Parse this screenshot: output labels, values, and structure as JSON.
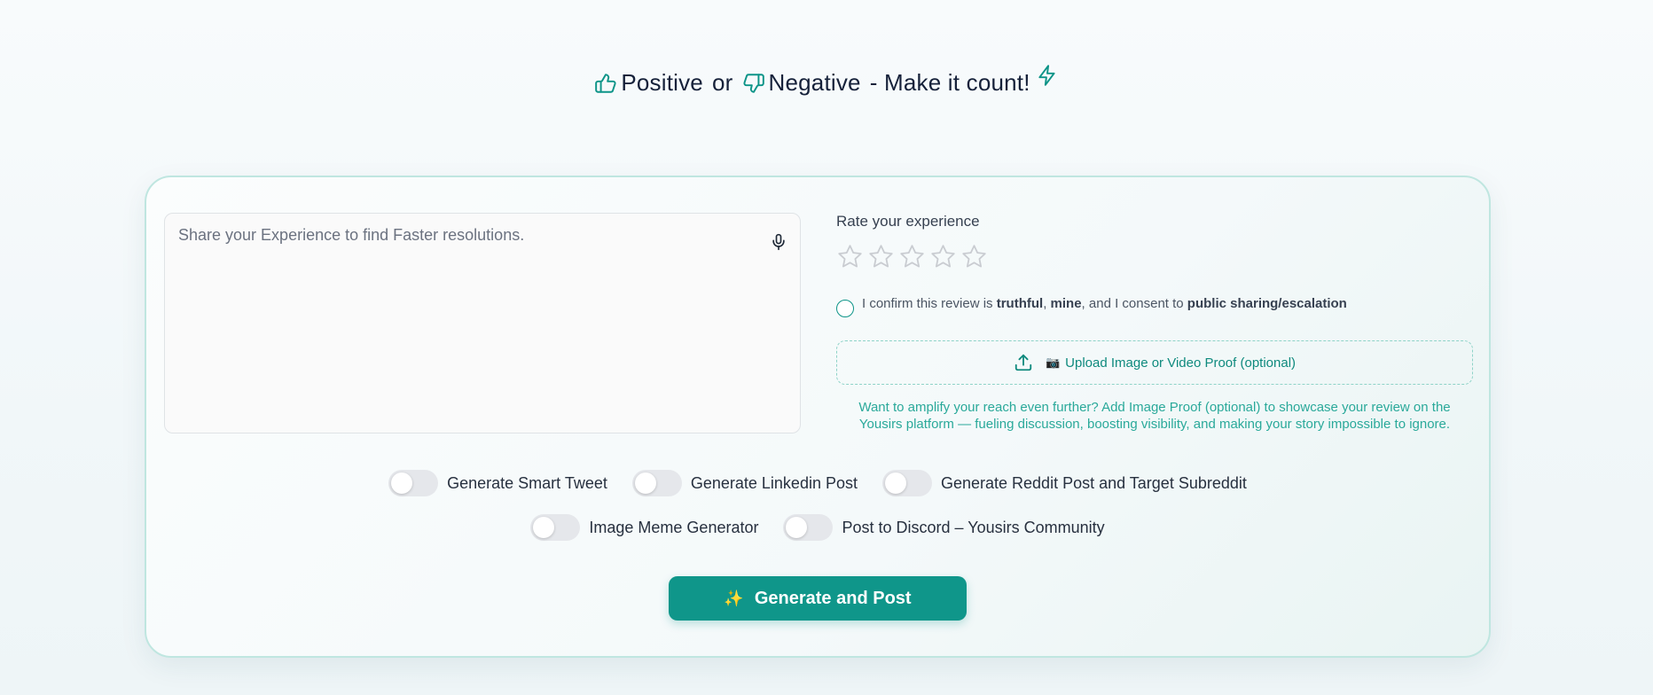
{
  "headline": {
    "positive": "Positive",
    "or": "or",
    "negative": "Negative",
    "tagline": "- Make it count!",
    "icons": [
      "thumbs-up-icon",
      "thumbs-down-icon",
      "lightning-icon"
    ],
    "accent_color": "#0d9488"
  },
  "review": {
    "placeholder": "Share your Experience to find Faster resolutions.",
    "mic_icon": "microphone-icon"
  },
  "rating": {
    "label": "Rate your experience",
    "max_stars": 5,
    "selected": 0
  },
  "consent": {
    "part1": "I confirm this review is ",
    "truthful": "truthful",
    "comma": ", ",
    "mine": "mine",
    "part2": ", and I consent to ",
    "public": "public sharing/escalation",
    "checked": false
  },
  "upload": {
    "camera": "📷",
    "label": "Upload Image or Video Proof (optional)"
  },
  "promo": {
    "line1": "Want to amplify your reach even further? Add Image Proof (optional) to showcase your review on the",
    "line2": "Yousirs platform — fueling discussion, boosting visibility, and making your story impossible to ignore."
  },
  "toggles": {
    "row1": [
      {
        "label": "Generate Smart Tweet",
        "on": false
      },
      {
        "label": "Generate Linkedin Post",
        "on": false
      },
      {
        "label": "Generate Reddit Post and Target Subreddit",
        "on": false
      }
    ],
    "row2": [
      {
        "label": "Image Meme Generator",
        "on": false
      },
      {
        "label": "Post to Discord – Yousirs Community",
        "on": false
      }
    ]
  },
  "submit": {
    "sparkle": "✨",
    "label": "Generate and Post",
    "color": "#0f968a"
  }
}
